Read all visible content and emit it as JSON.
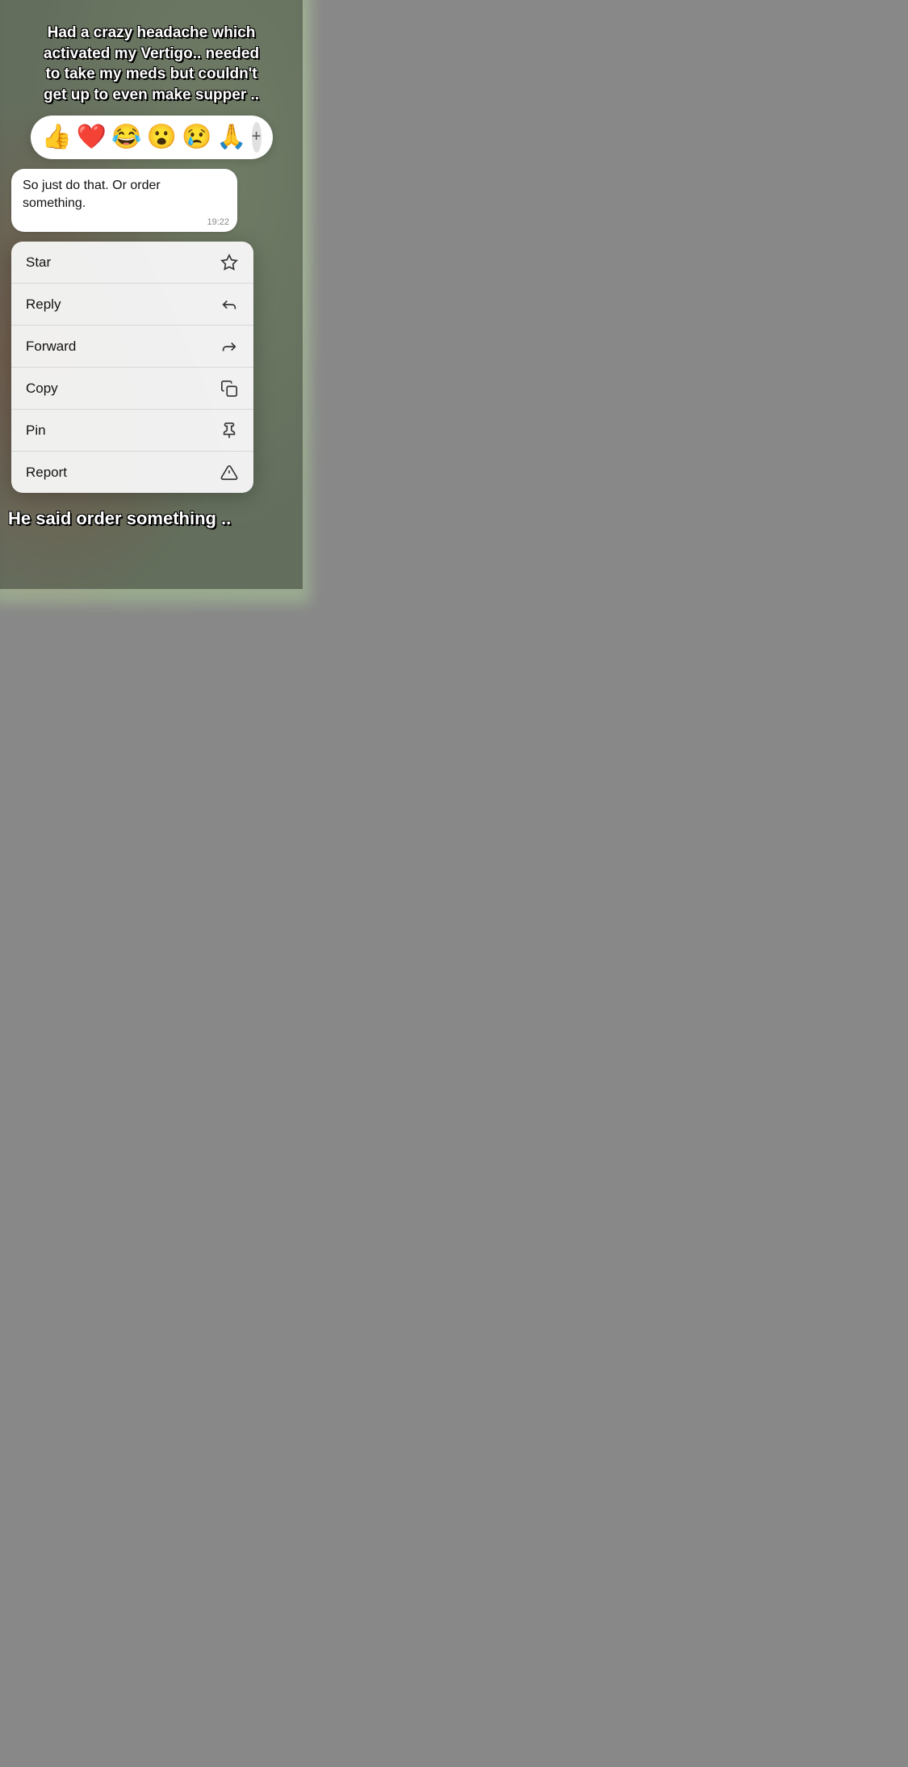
{
  "background": {
    "description": "blurred green/red bokeh background"
  },
  "caption": {
    "text": "Had a crazy headache which activated my Vertigo.. needed to take my meds but couldn't get up to even make supper .."
  },
  "emoji_bar": {
    "emojis": [
      "👍",
      "❤️",
      "😂",
      "😮",
      "😢",
      "🙏"
    ],
    "plus_icon": "+"
  },
  "message": {
    "text": "So just do that. Or order something.",
    "time": "19:22"
  },
  "context_menu": {
    "items": [
      {
        "label": "Star",
        "icon": "star"
      },
      {
        "label": "Reply",
        "icon": "reply"
      },
      {
        "label": "Forward",
        "icon": "forward"
      },
      {
        "label": "Copy",
        "icon": "copy"
      },
      {
        "label": "Pin",
        "icon": "pin"
      },
      {
        "label": "Report",
        "icon": "report"
      }
    ]
  },
  "subtitle": {
    "text": "He said order something .."
  }
}
